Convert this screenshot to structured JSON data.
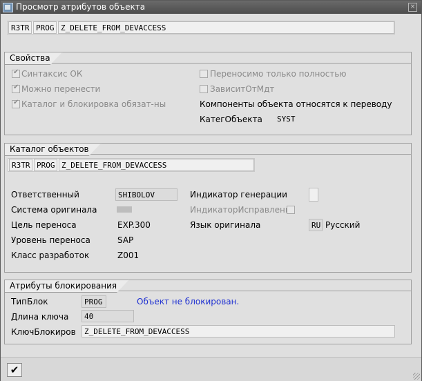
{
  "window": {
    "title": "Просмотр атрибутов объекта",
    "close_glyph": "×"
  },
  "header": {
    "pgmid": "R3TR",
    "object": "PROG",
    "obj_name": "Z_DELETE_FROM_DEVACCESS"
  },
  "properties": {
    "title": "Свойства",
    "syntax_ok": "Синтаксис ОК",
    "transportable": "Можно перенести",
    "catalog_lock": "Каталог и блокировка обязат-ны",
    "transport_full": "Переносимо только полностью",
    "depends_on": "ЗависитОтМдт",
    "components_translate": "Компоненты объекта относятся к переводу",
    "category_label": "КатегОбъекта",
    "category_value": "SYST"
  },
  "catalog": {
    "title": "Каталог объектов",
    "pgmid": "R3TR",
    "object": "PROG",
    "obj_name": "Z_DELETE_FROM_DEVACCESS",
    "owner_label": "Ответственный",
    "owner_value": "SHIBOLOV",
    "source_system_label": "Система оригинала",
    "target_label": "Цель переноса",
    "target_value": "EXP.300",
    "layer_label": "Уровень переноса",
    "layer_value": "SAP",
    "devclass_label": "Класс разработок",
    "devclass_value": "Z001",
    "gen_flag_label": "Индикатор генерации",
    "repair_flag_label": "ИндикаторИсправления",
    "lang_label": "Язык оригинала",
    "lang_code": "RU",
    "lang_name": "Русский"
  },
  "lock": {
    "title": "Атрибуты блокирования",
    "type_label": "ТипБлок",
    "type_value": "PROG",
    "status": "Объект не блокирован.",
    "keylen_label": "Длина ключа",
    "keylen_value": "40",
    "key_label": "КлючБлокиров",
    "key_value": "Z_DELETE_FROM_DEVACCESS"
  },
  "footer": {
    "ok_glyph": "✔"
  }
}
